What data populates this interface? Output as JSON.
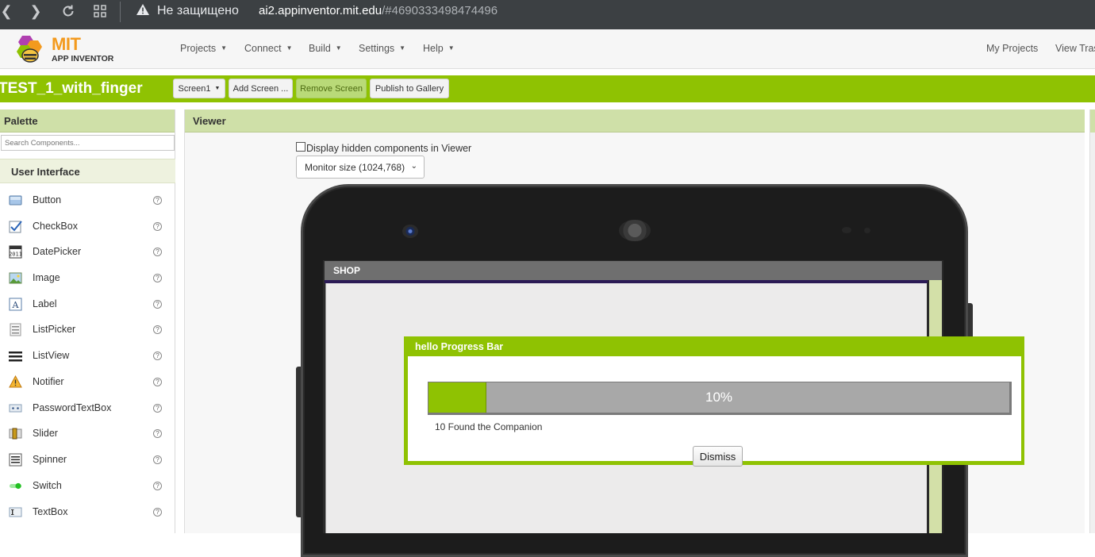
{
  "browser": {
    "insecure_label": "Не защищено",
    "url_host": "ai2.appinventor.mit.edu",
    "url_path": "/#4690333498474496"
  },
  "header": {
    "logo_text_top": "MIT",
    "logo_text_bottom": "APP INVENTOR",
    "menu": [
      "Projects",
      "Connect",
      "Build",
      "Settings",
      "Help"
    ],
    "right_links": [
      "My Projects",
      "View Tras"
    ]
  },
  "toolbar": {
    "project_name": "TEST_1_with_finger",
    "screen_select": "Screen1",
    "add_screen": "Add Screen ...",
    "remove_screen": "Remove Screen",
    "publish": "Publish to Gallery"
  },
  "palette": {
    "title": "Palette",
    "search_placeholder": "Search Components...",
    "category": "User Interface",
    "items": [
      {
        "label": "Button",
        "icon": "button-icon"
      },
      {
        "label": "CheckBox",
        "icon": "checkbox-icon"
      },
      {
        "label": "DatePicker",
        "icon": "datepicker-icon"
      },
      {
        "label": "Image",
        "icon": "image-icon"
      },
      {
        "label": "Label",
        "icon": "label-icon"
      },
      {
        "label": "ListPicker",
        "icon": "listpicker-icon"
      },
      {
        "label": "ListView",
        "icon": "listview-icon"
      },
      {
        "label": "Notifier",
        "icon": "notifier-icon"
      },
      {
        "label": "PasswordTextBox",
        "icon": "passwordtextbox-icon"
      },
      {
        "label": "Slider",
        "icon": "slider-icon"
      },
      {
        "label": "Spinner",
        "icon": "spinner-icon"
      },
      {
        "label": "Switch",
        "icon": "switch-icon"
      },
      {
        "label": "TextBox",
        "icon": "textbox-icon"
      }
    ],
    "help_glyph": "?"
  },
  "viewer": {
    "title": "Viewer",
    "hidden_components_label": "Display hidden components in Viewer",
    "hidden_components_checked": false,
    "monitor_size": "Monitor size (1024,768)",
    "screen_title": "SHOP"
  },
  "dialog": {
    "title": "hello Progress Bar",
    "progress_percent": 10,
    "progress_text": "10%",
    "message": "10 Found the Companion",
    "dismiss_label": "Dismiss"
  },
  "colors": {
    "brand_green": "#8fc202",
    "panel_header": "#cfe0a8",
    "logo_orange": "#f39a1e"
  }
}
